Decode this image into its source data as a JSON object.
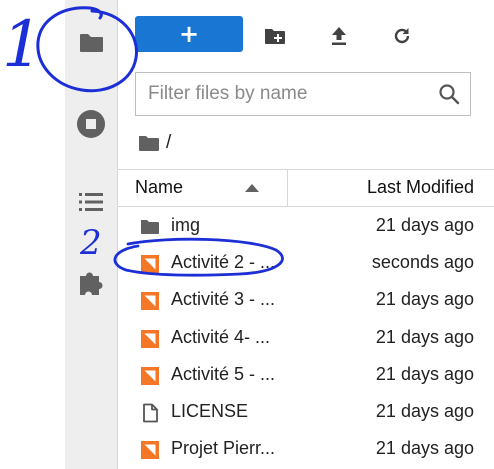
{
  "sidebar": {
    "items": [
      {
        "icon": "folder-icon"
      },
      {
        "icon": "stop-circle-icon"
      },
      {
        "icon": "table-of-contents-icon"
      },
      {
        "icon": "puzzle-extension-icon"
      }
    ]
  },
  "toolbar": {
    "new_launcher_label": "+"
  },
  "filter": {
    "placeholder": "Filter files by name"
  },
  "breadcrumb": {
    "separator": "/"
  },
  "list_header": {
    "name": "Name",
    "last_modified": "Last Modified"
  },
  "files": [
    {
      "type": "folder",
      "name": "img",
      "modified": "21 days ago"
    },
    {
      "type": "notebook",
      "name": "Activité 2 - ...",
      "modified": "seconds ago"
    },
    {
      "type": "notebook",
      "name": "Activité 3 - ...",
      "modified": "21 days ago"
    },
    {
      "type": "notebook",
      "name": "Activité 4- ...",
      "modified": "21 days ago"
    },
    {
      "type": "notebook",
      "name": "Activité 5 - ...",
      "modified": "21 days ago"
    },
    {
      "type": "file",
      "name": "LICENSE",
      "modified": "21 days ago"
    },
    {
      "type": "notebook",
      "name": "Projet Pierr...",
      "modified": "21 days ago"
    }
  ],
  "annotations": {
    "mark_1": "1",
    "mark_2": "2"
  },
  "colors": {
    "accent": "#1976d2",
    "notebook_icon": "#f37726",
    "annotation_ink": "#1c2fd6",
    "sidebar_bg": "#eeeeee",
    "icon_gray": "#616161"
  }
}
